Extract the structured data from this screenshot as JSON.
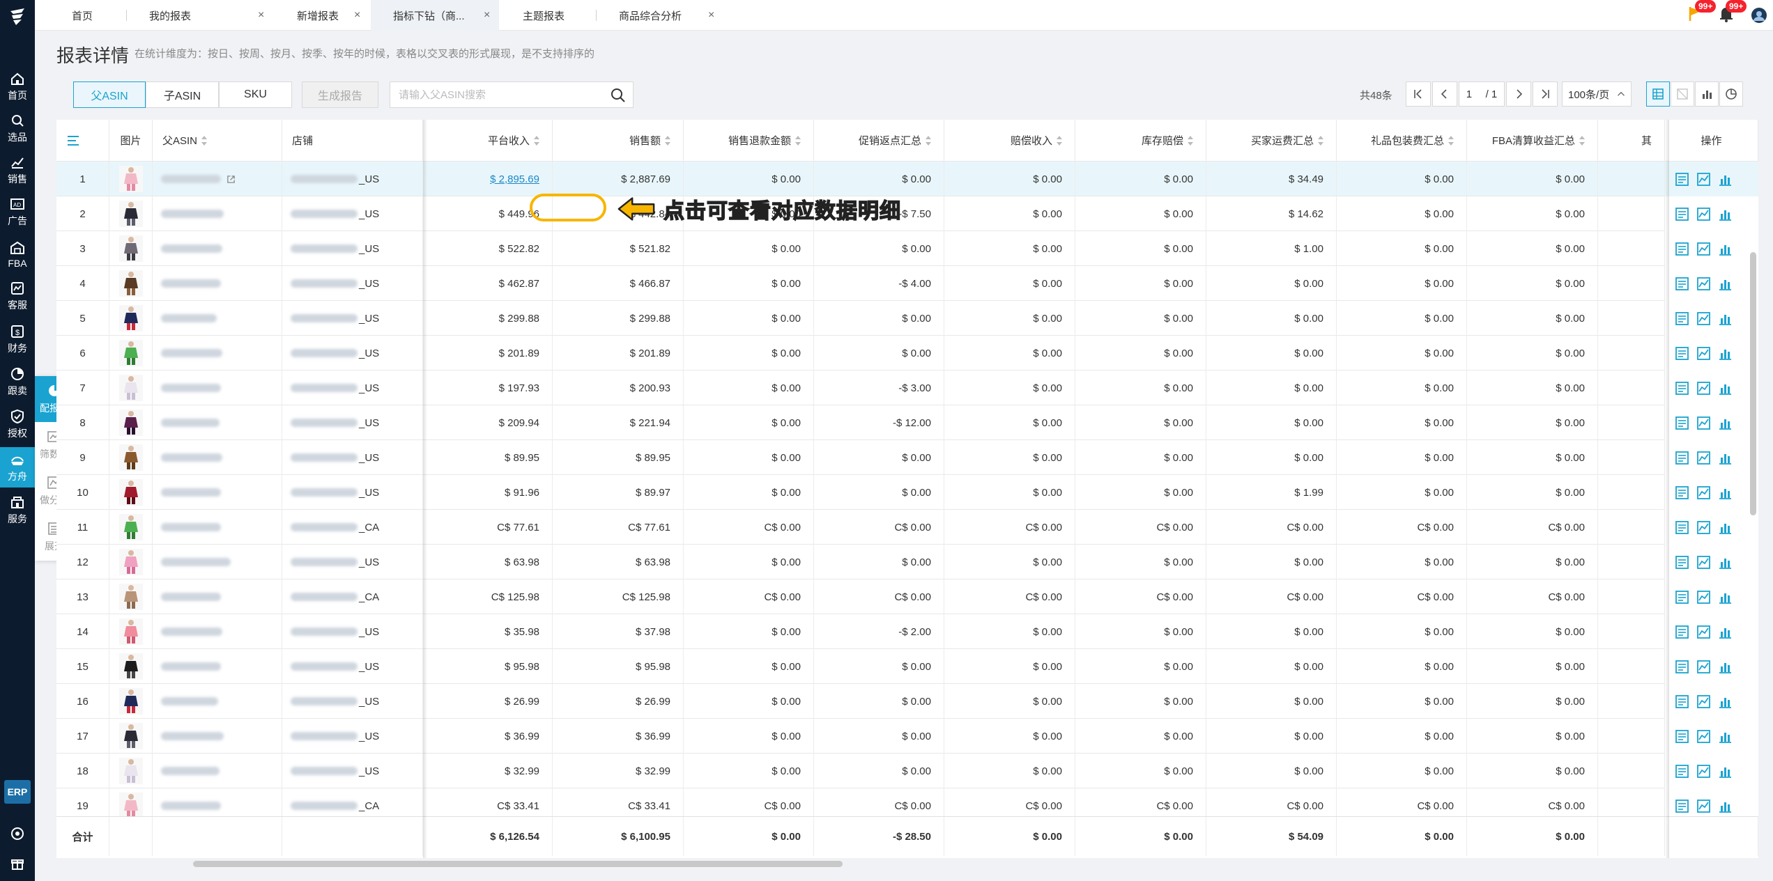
{
  "tabs": [
    {
      "label": "首页",
      "active": false,
      "closable": false
    },
    {
      "label": "我的报表",
      "active": false,
      "closable": true
    },
    {
      "label": "新增报表",
      "active": false,
      "closable": true
    },
    {
      "label": "指标下钻（商...",
      "active": true,
      "closable": true
    },
    {
      "label": "主题报表",
      "active": false,
      "closable": false
    },
    {
      "label": "商品综合分析",
      "active": false,
      "closable": true
    }
  ],
  "notifications": {
    "flag_count": "99+",
    "bell_count": "99+"
  },
  "sidebar": {
    "items": [
      {
        "label": "首页",
        "icon": "home-icon"
      },
      {
        "label": "选品",
        "icon": "search-icon"
      },
      {
        "label": "销售",
        "icon": "chart-icon"
      },
      {
        "label": "广告",
        "icon": "ad-icon"
      },
      {
        "label": "FBA",
        "icon": "warehouse-icon"
      },
      {
        "label": "客服",
        "icon": "service-icon"
      },
      {
        "label": "财务",
        "icon": "finance-icon"
      },
      {
        "label": "跟卖",
        "icon": "follow-icon"
      },
      {
        "label": "授权",
        "icon": "shield-icon"
      },
      {
        "label": "方舟",
        "icon": "ark-icon"
      },
      {
        "label": "服务",
        "icon": "store-icon"
      }
    ],
    "erp_label": "ERP"
  },
  "floating_panel": {
    "items": [
      {
        "label": "配报表",
        "icon": "pie-icon"
      },
      {
        "label": "筛数据",
        "icon": "filter-chart-icon"
      },
      {
        "label": "做分析",
        "icon": "analysis-icon"
      },
      {
        "label": "展开",
        "icon": "expand-icon"
      }
    ]
  },
  "page": {
    "title": "报表详情",
    "description": "在统计维度为：按日、按周、按月、按季、按年的时候，表格以交叉表的形式展现，是不支持排序的"
  },
  "toolbar": {
    "segments": [
      "父ASIN",
      "子ASIN",
      "SKU"
    ],
    "generate_label": "生成报告",
    "search_placeholder": "请输入父ASIN搜索",
    "total_label": "共48条",
    "page_current": "1",
    "page_total": "/ 1",
    "page_size": "100条/页"
  },
  "table": {
    "columns": [
      "图片",
      "父ASIN",
      "店铺",
      "平台收入",
      "销售额",
      "销售退款金额",
      "促销返点汇总",
      "赔偿收入",
      "库存赔偿",
      "买家运费汇总",
      "礼品包装费汇总",
      "FBA清算收益汇总",
      "其",
      "操作"
    ],
    "rows": [
      {
        "n": "1",
        "store_suffix": "_US",
        "img": "pink-top",
        "vals": [
          "$ 2,895.69",
          "$ 2,887.69",
          "$ 0.00",
          "$ 0.00",
          "$ 0.00",
          "$ 0.00",
          "$ 34.49",
          "$ 0.00",
          "$ 0.00"
        ]
      },
      {
        "n": "2",
        "store_suffix": "_US",
        "img": "dark-outfit",
        "vals": [
          "$ 449.96",
          "$ 442.84",
          "$ 0.00",
          "-$ 7.50",
          "$ 0.00",
          "$ 0.00",
          "$ 14.62",
          "$ 0.00",
          "$ 0.00"
        ]
      },
      {
        "n": "3",
        "store_suffix": "_US",
        "img": "gray-dress",
        "vals": [
          "$ 522.82",
          "$ 521.82",
          "$ 0.00",
          "$ 0.00",
          "$ 0.00",
          "$ 0.00",
          "$ 1.00",
          "$ 0.00",
          "$ 0.00"
        ]
      },
      {
        "n": "4",
        "store_suffix": "_US",
        "img": "brown-outfit",
        "vals": [
          "$ 462.87",
          "$ 466.87",
          "$ 0.00",
          "-$ 4.00",
          "$ 0.00",
          "$ 0.00",
          "$ 0.00",
          "$ 0.00",
          "$ 0.00"
        ]
      },
      {
        "n": "5",
        "store_suffix": "_US",
        "img": "navy-red",
        "vals": [
          "$ 299.88",
          "$ 299.88",
          "$ 0.00",
          "$ 0.00",
          "$ 0.00",
          "$ 0.00",
          "$ 0.00",
          "$ 0.00",
          "$ 0.00"
        ]
      },
      {
        "n": "6",
        "store_suffix": "_US",
        "img": "green-pants",
        "vals": [
          "$ 201.89",
          "$ 201.89",
          "$ 0.00",
          "$ 0.00",
          "$ 0.00",
          "$ 0.00",
          "$ 0.00",
          "$ 0.00",
          "$ 0.00"
        ]
      },
      {
        "n": "7",
        "store_suffix": "_US",
        "img": "white-dress",
        "vals": [
          "$ 197.93",
          "$ 200.93",
          "$ 0.00",
          "-$ 3.00",
          "$ 0.00",
          "$ 0.00",
          "$ 0.00",
          "$ 0.00",
          "$ 0.00"
        ]
      },
      {
        "n": "8",
        "store_suffix": "_US",
        "img": "purple-dress",
        "vals": [
          "$ 209.94",
          "$ 221.94",
          "$ 0.00",
          "-$ 12.00",
          "$ 0.00",
          "$ 0.00",
          "$ 0.00",
          "$ 0.00",
          "$ 0.00"
        ]
      },
      {
        "n": "9",
        "store_suffix": "_US",
        "img": "brown-coat",
        "vals": [
          "$ 89.95",
          "$ 89.95",
          "$ 0.00",
          "$ 0.00",
          "$ 0.00",
          "$ 0.00",
          "$ 0.00",
          "$ 0.00",
          "$ 0.00"
        ]
      },
      {
        "n": "10",
        "store_suffix": "_US",
        "img": "red-dress",
        "vals": [
          "$ 91.96",
          "$ 89.97",
          "$ 0.00",
          "$ 0.00",
          "$ 0.00",
          "$ 0.00",
          "$ 1.99",
          "$ 0.00",
          "$ 0.00"
        ]
      },
      {
        "n": "11",
        "store_suffix": "_CA",
        "img": "green-pants",
        "vals": [
          "C$ 77.61",
          "C$ 77.61",
          "C$ 0.00",
          "C$ 0.00",
          "C$ 0.00",
          "C$ 0.00",
          "C$ 0.00",
          "C$ 0.00",
          "C$ 0.00"
        ]
      },
      {
        "n": "12",
        "store_suffix": "_US",
        "img": "pink-set",
        "vals": [
          "$ 63.98",
          "$ 63.98",
          "$ 0.00",
          "$ 0.00",
          "$ 0.00",
          "$ 0.00",
          "$ 0.00",
          "$ 0.00",
          "$ 0.00"
        ]
      },
      {
        "n": "13",
        "store_suffix": "_CA",
        "img": "tan-outfit",
        "vals": [
          "C$ 125.98",
          "C$ 125.98",
          "C$ 0.00",
          "C$ 0.00",
          "C$ 0.00",
          "C$ 0.00",
          "C$ 0.00",
          "C$ 0.00",
          "C$ 0.00"
        ]
      },
      {
        "n": "14",
        "store_suffix": "_US",
        "img": "pink-dress",
        "vals": [
          "$ 35.98",
          "$ 37.98",
          "$ 0.00",
          "-$ 2.00",
          "$ 0.00",
          "$ 0.00",
          "$ 0.00",
          "$ 0.00",
          "$ 0.00"
        ]
      },
      {
        "n": "15",
        "store_suffix": "_US",
        "img": "black-top",
        "vals": [
          "$ 95.98",
          "$ 95.98",
          "$ 0.00",
          "$ 0.00",
          "$ 0.00",
          "$ 0.00",
          "$ 0.00",
          "$ 0.00",
          "$ 0.00"
        ]
      },
      {
        "n": "16",
        "store_suffix": "_US",
        "img": "navy-red",
        "vals": [
          "$ 26.99",
          "$ 26.99",
          "$ 0.00",
          "$ 0.00",
          "$ 0.00",
          "$ 0.00",
          "$ 0.00",
          "$ 0.00",
          "$ 0.00"
        ]
      },
      {
        "n": "17",
        "store_suffix": "_US",
        "img": "dark-outfit",
        "vals": [
          "$ 36.99",
          "$ 36.99",
          "$ 0.00",
          "$ 0.00",
          "$ 0.00",
          "$ 0.00",
          "$ 0.00",
          "$ 0.00",
          "$ 0.00"
        ]
      },
      {
        "n": "18",
        "store_suffix": "_US",
        "img": "white-dress",
        "vals": [
          "$ 32.99",
          "$ 32.99",
          "$ 0.00",
          "$ 0.00",
          "$ 0.00",
          "$ 0.00",
          "$ 0.00",
          "$ 0.00",
          "$ 0.00"
        ]
      },
      {
        "n": "19",
        "store_suffix": "_CA",
        "img": "pink-top",
        "vals": [
          "C$ 33.41",
          "C$ 33.41",
          "C$ 0.00",
          "C$ 0.00",
          "C$ 0.00",
          "C$ 0.00",
          "C$ 0.00",
          "C$ 0.00",
          "C$ 0.00"
        ]
      }
    ],
    "total": {
      "label": "合计",
      "vals": [
        "$ 6,126.54",
        "$ 6,100.95",
        "$ 0.00",
        "-$ 28.50",
        "$ 0.00",
        "$ 0.00",
        "$ 54.09",
        "$ 0.00",
        "$ 0.00"
      ]
    }
  },
  "annotation": {
    "text": "点击可查看对应数据明细"
  },
  "colors": {
    "accent": "#1aa3d0",
    "sidebar_bg": "#0d1b2e",
    "annotation": "#f7b500",
    "link": "#1a88c9"
  }
}
